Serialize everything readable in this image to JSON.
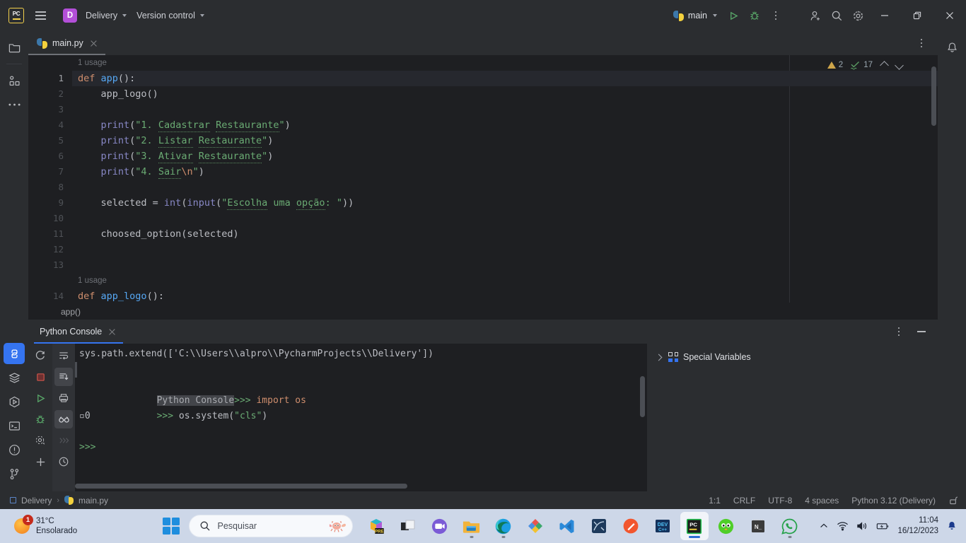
{
  "titlebar": {
    "logo_icon": "pycharm-logo-icon",
    "menu_icon": "hamburger-menu-icon",
    "project_badge": "D",
    "project_name": "Delivery",
    "version_control": "Version control",
    "run_config": "main",
    "run_icon": "run-triangle-icon",
    "debug_icon": "debug-bug-icon",
    "more_icon": "more-vertical-icon",
    "account_icon": "add-user-icon",
    "search_icon": "search-icon",
    "settings_icon": "gear-icon",
    "minimize_icon": "minimize-icon",
    "maximize_icon": "maximize-restore-icon",
    "close_icon": "close-icon"
  },
  "left_rail": {
    "top": [
      {
        "name": "project-tool-window",
        "icon": "folder-icon"
      },
      {
        "name": "structure-tool-window",
        "icon": "structure-icon"
      },
      {
        "name": "more-tool-windows",
        "icon": "ellipsis-icon"
      }
    ],
    "bottom": [
      {
        "name": "python-console-tool-window",
        "icon": "python-console-icon",
        "active": true
      },
      {
        "name": "services-tool-window",
        "icon": "layers-icon"
      },
      {
        "name": "run-tool-window",
        "icon": "run-hexagon-icon"
      },
      {
        "name": "terminal-tool-window",
        "icon": "terminal-icon"
      },
      {
        "name": "problems-tool-window",
        "icon": "exclamation-circle-icon"
      },
      {
        "name": "version-control-tool-window",
        "icon": "git-branch-icon"
      }
    ]
  },
  "right_rail": [
    {
      "name": "notifications-tool-window",
      "icon": "bell-icon"
    }
  ],
  "editor": {
    "tab": {
      "label": "main.py",
      "icon": "python-file-icon",
      "close_icon": "close-icon"
    },
    "tabrow_more_icon": "more-vertical-icon",
    "inspections": {
      "warning_icon": "warning-triangle-icon",
      "warning_count": "2",
      "check_icon": "check-squiggle-icon",
      "check_count": "17",
      "prev_icon": "chevron-up-icon",
      "next_icon": "chevron-down-icon"
    },
    "usage_hint_1": "1 usage",
    "usage_hint_2": "1 usage",
    "line_numbers": [
      "1",
      "2",
      "3",
      "4",
      "5",
      "6",
      "7",
      "8",
      "9",
      "10",
      "11",
      "12",
      "13",
      "14"
    ],
    "lines": [
      "def app():",
      "    app_logo()",
      "",
      "    print(\"1. Cadastrar Restaurante\")",
      "    print(\"2. Listar Restaurante\")",
      "    print(\"3. Ativar Restaurante\")",
      "    print(\"4. Sair\\n\")",
      "",
      "    selected = int(input(\"Escolha uma opção: \"))",
      "",
      "    choosed_option(selected)",
      "",
      "",
      "def app_logo():"
    ],
    "breadcrumb": "app()"
  },
  "console_panel": {
    "tab": {
      "label": "Python Console",
      "close_icon": "close-icon"
    },
    "options_icon": "more-vertical-icon",
    "minimize_icon": "minimize-icon",
    "toolbar_left": [
      {
        "name": "rerun-button",
        "icon": "rerun-icon"
      },
      {
        "name": "stop-button",
        "icon": "stop-square-icon"
      },
      {
        "name": "run-button",
        "icon": "run-triangle-icon"
      },
      {
        "name": "debug-button",
        "icon": "debug-bug-icon"
      },
      {
        "name": "settings-button",
        "icon": "gear-icon"
      },
      {
        "name": "new-console-button",
        "icon": "plus-icon"
      }
    ],
    "toolbar_right": [
      {
        "name": "soft-wrap-button",
        "icon": "soft-wrap-icon",
        "active": false
      },
      {
        "name": "scroll-to-end-button",
        "icon": "scroll-to-end-icon",
        "active": true
      },
      {
        "name": "print-button",
        "icon": "printer-icon",
        "active": false
      },
      {
        "name": "use-soft-wraps-button",
        "icon": "glasses-icon",
        "active": true
      },
      {
        "name": "execute-button",
        "icon": "chevrons-right-icon",
        "disabled": true
      },
      {
        "name": "history-button",
        "icon": "clock-icon",
        "active": false
      }
    ],
    "output_lines": [
      {
        "type": "plain",
        "text": "sys.path.extend(['C:\\\\Users\\\\alpro\\\\PycharmProjects\\\\Delivery'])"
      },
      {
        "type": "blank",
        "text": ""
      },
      {
        "type": "tagged",
        "tag": "Python Console",
        "prompt": ">>> ",
        "code": "import os"
      },
      {
        "type": "input",
        "prompt": ">>> ",
        "code": "os.system(\"cls\")"
      },
      {
        "type": "result",
        "text": "▫0"
      },
      {
        "type": "blank",
        "text": ""
      },
      {
        "type": "prompt_only",
        "prompt": ">>>"
      }
    ],
    "variables": {
      "special_variables_label": "Special Variables",
      "expand_icon": "chevron-right-icon",
      "grid_icon": "variables-grid-icon"
    }
  },
  "statusbar": {
    "project_icon": "project-square-icon",
    "project": "Delivery",
    "separator": "›",
    "file_icon": "python-file-icon",
    "file": "main.py",
    "caret": "1:1",
    "line_separator": "CRLF",
    "encoding": "UTF-8",
    "indent": "4 spaces",
    "interpreter": "Python 3.12 (Delivery)",
    "lock_icon": "unlocked-padlock-icon"
  },
  "taskbar": {
    "weather": {
      "temp": "31°C",
      "condition": "Ensolarado",
      "badge": "1",
      "icon": "sun-icon"
    },
    "start_icon": "windows-start-icon",
    "search": {
      "placeholder": "Pesquisar",
      "icon": "search-icon",
      "mascot_icon": "axolotl-icon"
    },
    "apps": [
      {
        "name": "taskbar-copilot",
        "icon": "copilot-icon",
        "badge": "PRE"
      },
      {
        "name": "taskbar-task-view",
        "icon": "task-view-icon"
      },
      {
        "name": "taskbar-teams",
        "icon": "teams-chat-icon"
      },
      {
        "name": "taskbar-file-explorer",
        "icon": "file-explorer-icon",
        "running": true
      },
      {
        "name": "taskbar-edge",
        "icon": "edge-icon",
        "running": true
      },
      {
        "name": "taskbar-microsoft-365",
        "icon": "microsoft-365-icon"
      },
      {
        "name": "taskbar-vs-code",
        "icon": "vs-code-icon"
      },
      {
        "name": "taskbar-graph-app",
        "icon": "graph-app-icon"
      },
      {
        "name": "taskbar-pen-app",
        "icon": "pen-circle-icon"
      },
      {
        "name": "taskbar-dev-cpp",
        "icon": "dev-cpp-icon"
      },
      {
        "name": "taskbar-pycharm",
        "icon": "pycharm-icon",
        "active": true
      },
      {
        "name": "taskbar-duolingo",
        "icon": "duolingo-owl-icon"
      },
      {
        "name": "taskbar-notepad-n",
        "icon": "notepad-n-icon"
      },
      {
        "name": "taskbar-whatsapp",
        "icon": "whatsapp-icon",
        "running": true
      }
    ],
    "tray": {
      "chevron_icon": "chevron-up-icon",
      "wifi_icon": "wifi-icon",
      "volume_icon": "volume-icon",
      "battery_icon": "battery-charging-icon",
      "time": "11:04",
      "date": "16/12/2023",
      "bell_icon": "notification-bell-icon"
    }
  }
}
